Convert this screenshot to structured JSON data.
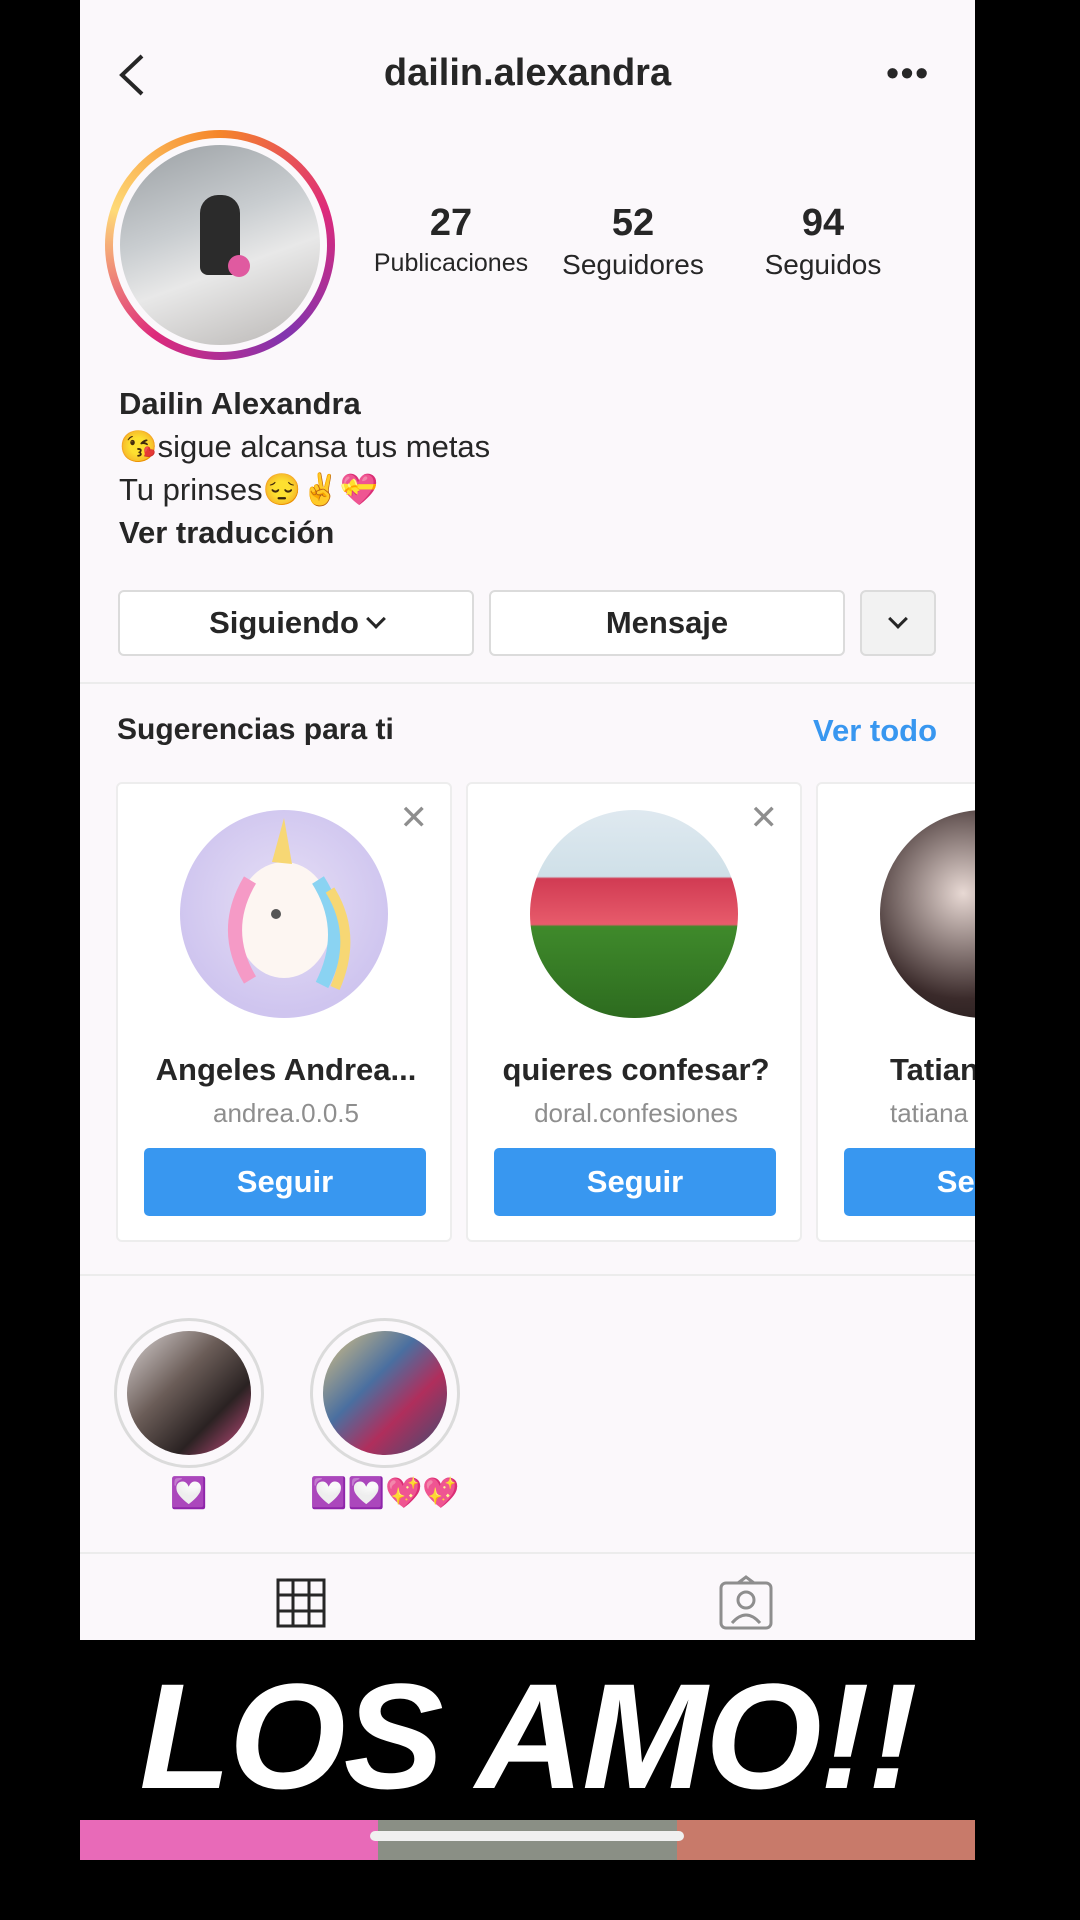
{
  "header": {
    "username": "dailin.alexandra",
    "more": "•••"
  },
  "stats": [
    {
      "value": "27",
      "label": "Publicaciones"
    },
    {
      "value": "52",
      "label": "Seguidores"
    },
    {
      "value": "94",
      "label": "Seguidos"
    }
  ],
  "bio": {
    "name": "Dailin Alexandra",
    "line1": "😘sigue alcansa tus metas",
    "line2": "Tu prinses😔✌️💝",
    "translate": "Ver traducción"
  },
  "actions": {
    "following": "Siguiendo",
    "message": "Mensaje"
  },
  "suggestions": {
    "title": "Sugerencias para ti",
    "see_all": "Ver todo",
    "close": "✕",
    "cards": [
      {
        "name": "Angeles Andrea...",
        "username": "andrea.0.0.5",
        "button": "Seguir"
      },
      {
        "name": "quieres confesar?",
        "username": "doral.confesiones",
        "button": "Seguir"
      },
      {
        "name": "Tatiana",
        "username": "tatiana",
        "button": "Seguir"
      }
    ]
  },
  "highlights": [
    {
      "label": "💟"
    },
    {
      "label": "💟💟💖💖"
    }
  ],
  "overlay": {
    "text": "LOS AMO!!"
  },
  "colors": {
    "accent": "#3897f0",
    "background": "#fbf8fb"
  }
}
